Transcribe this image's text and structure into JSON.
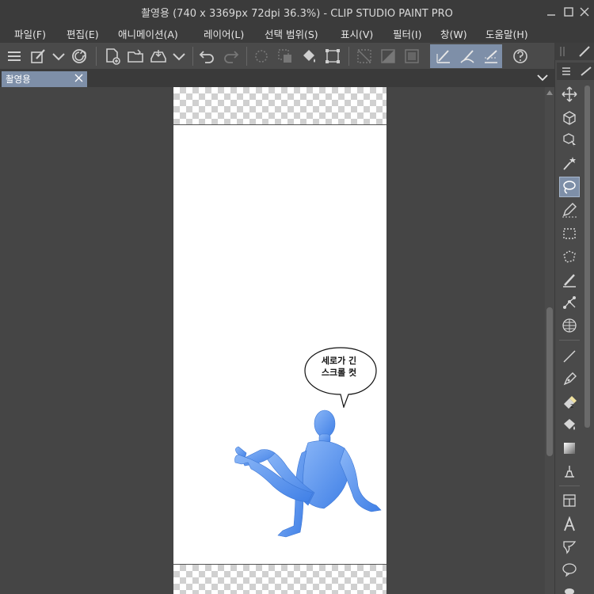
{
  "window": {
    "title": "촬영용 (740 x 3369px 72dpi 36.3%)  - CLIP STUDIO PAINT PRO"
  },
  "menu": [
    {
      "label": "파일(F)"
    },
    {
      "label": "편집(E)"
    },
    {
      "label": "애니메이션(A)"
    },
    {
      "label": "레이어(L)"
    },
    {
      "label": "선택 범위(S)"
    },
    {
      "label": "표시(V)"
    },
    {
      "label": "필터(I)"
    },
    {
      "label": "창(W)"
    },
    {
      "label": "도움말(H)"
    }
  ],
  "tabs": [
    {
      "label": "촬영용",
      "active": true
    }
  ],
  "canvas": {
    "speech_bubble_text": [
      "세로가 긴",
      "스크롤 컷"
    ]
  },
  "toolbar_icons": [
    "menu-icon",
    "brush-settings-icon",
    "chevron-down-icon",
    "clip-studio-logo-icon",
    "new-document-icon",
    "open-folder-icon",
    "save-icon",
    "chevron-down-icon",
    "undo-icon",
    "redo-icon",
    "clear-icon",
    "fill-selection-icon",
    "fill-icon",
    "transform-icon",
    "deselect-icon",
    "invert-selection-icon",
    "show-selection-icon",
    "ruler-snap-icon",
    "special-ruler-snap-icon",
    "grid-snap-icon",
    "help-icon"
  ],
  "palette_tools": [
    "move-icon",
    "object-3d-icon",
    "object-select-icon",
    "auto-action-icon",
    "lasso-icon",
    "eyedropper-pen-icon",
    "rectangle-select-icon",
    "polyline-select-icon",
    "pen-icon",
    "vector-icon",
    "grid-icon",
    "line-icon",
    "pen-tool-icon",
    "eraser-icon",
    "fill-bucket-icon",
    "gradient-icon",
    "blend-icon",
    "frame-icon",
    "text-icon",
    "balloon-tail-icon",
    "balloon-icon",
    "more-icon"
  ],
  "colors": {
    "accent": "#7e8fa8",
    "figure": "#5e97ef",
    "window": "#3b3b3b",
    "panel": "#4a4a4a"
  }
}
